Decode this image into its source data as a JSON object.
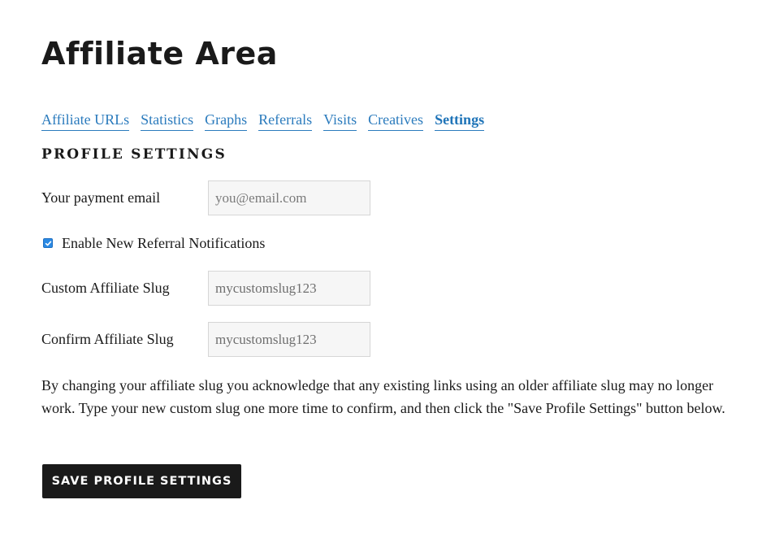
{
  "page": {
    "title": "Affiliate Area"
  },
  "tabs": [
    {
      "label": "Affiliate URLs",
      "active": false
    },
    {
      "label": "Statistics",
      "active": false
    },
    {
      "label": "Graphs",
      "active": false
    },
    {
      "label": "Referrals",
      "active": false
    },
    {
      "label": "Visits",
      "active": false
    },
    {
      "label": "Creatives",
      "active": false
    },
    {
      "label": "Settings",
      "active": true
    }
  ],
  "profile": {
    "heading": "PROFILE SETTINGS",
    "payment_email": {
      "label": "Your payment email",
      "value": "",
      "placeholder": "you@email.com"
    },
    "notifications": {
      "label": "Enable New Referral Notifications",
      "checked": true
    },
    "custom_slug": {
      "label": "Custom Affiliate Slug",
      "value": "mycustomslug123"
    },
    "confirm_slug": {
      "label": "Confirm Affiliate Slug",
      "value": "mycustomslug123"
    },
    "notice": "By changing your affiliate slug you acknowledge that any existing links using an older affiliate slug may no longer work. Type your new custom slug one more time to confirm, and then click the \"Save Profile Settings\" button below.",
    "save_label": "SAVE PROFILE SETTINGS"
  },
  "colors": {
    "link": "#2b7bbd",
    "button_bg": "#1a1a1a",
    "checkbox": "#2b8ae4"
  }
}
